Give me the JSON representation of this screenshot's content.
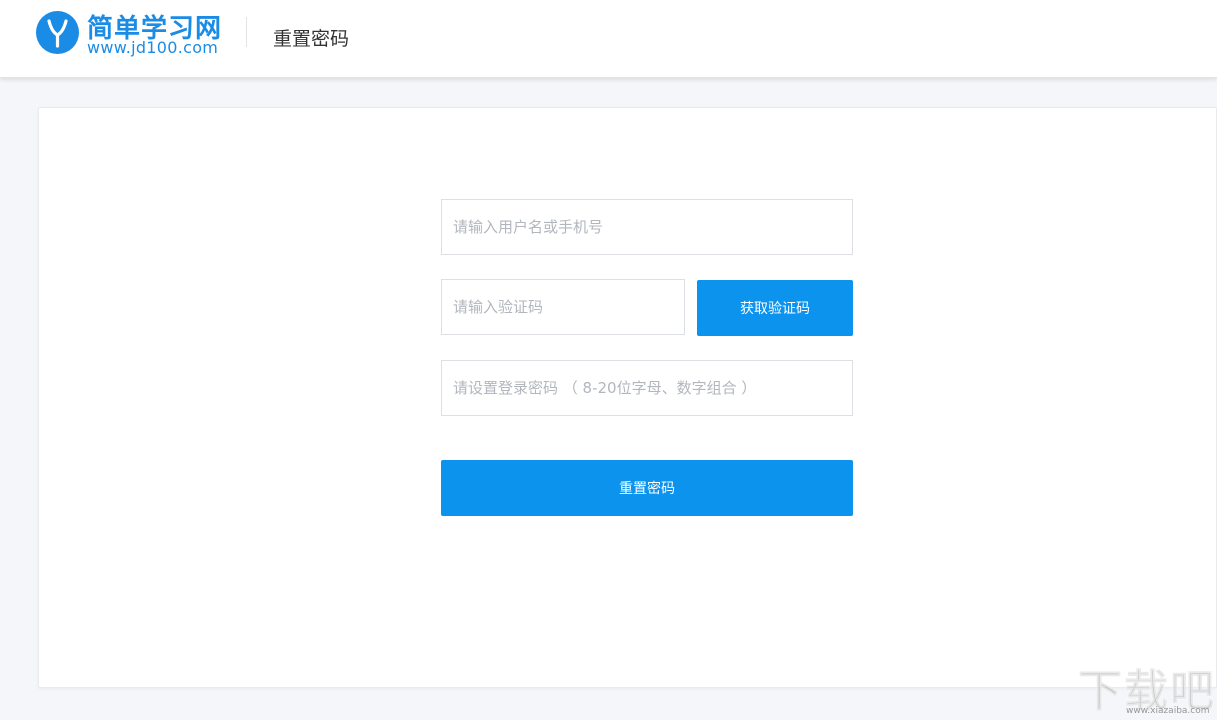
{
  "header": {
    "logo_title": "简单学习网",
    "logo_url": "www.jd100.com",
    "page_title": "重置密码"
  },
  "form": {
    "username_placeholder": "请输入用户名或手机号",
    "code_placeholder": "请输入验证码",
    "get_code_label": "获取验证码",
    "password_placeholder": "请设置登录密码 （ 8-20位字母、数字组合 ）",
    "submit_label": "重置密码"
  },
  "watermark": {
    "text": "下载吧",
    "url": "www.xiazaiba.com"
  },
  "colors": {
    "brand": "#1b8ce5",
    "button": "#0b93ee",
    "background": "#f4f6fa"
  }
}
